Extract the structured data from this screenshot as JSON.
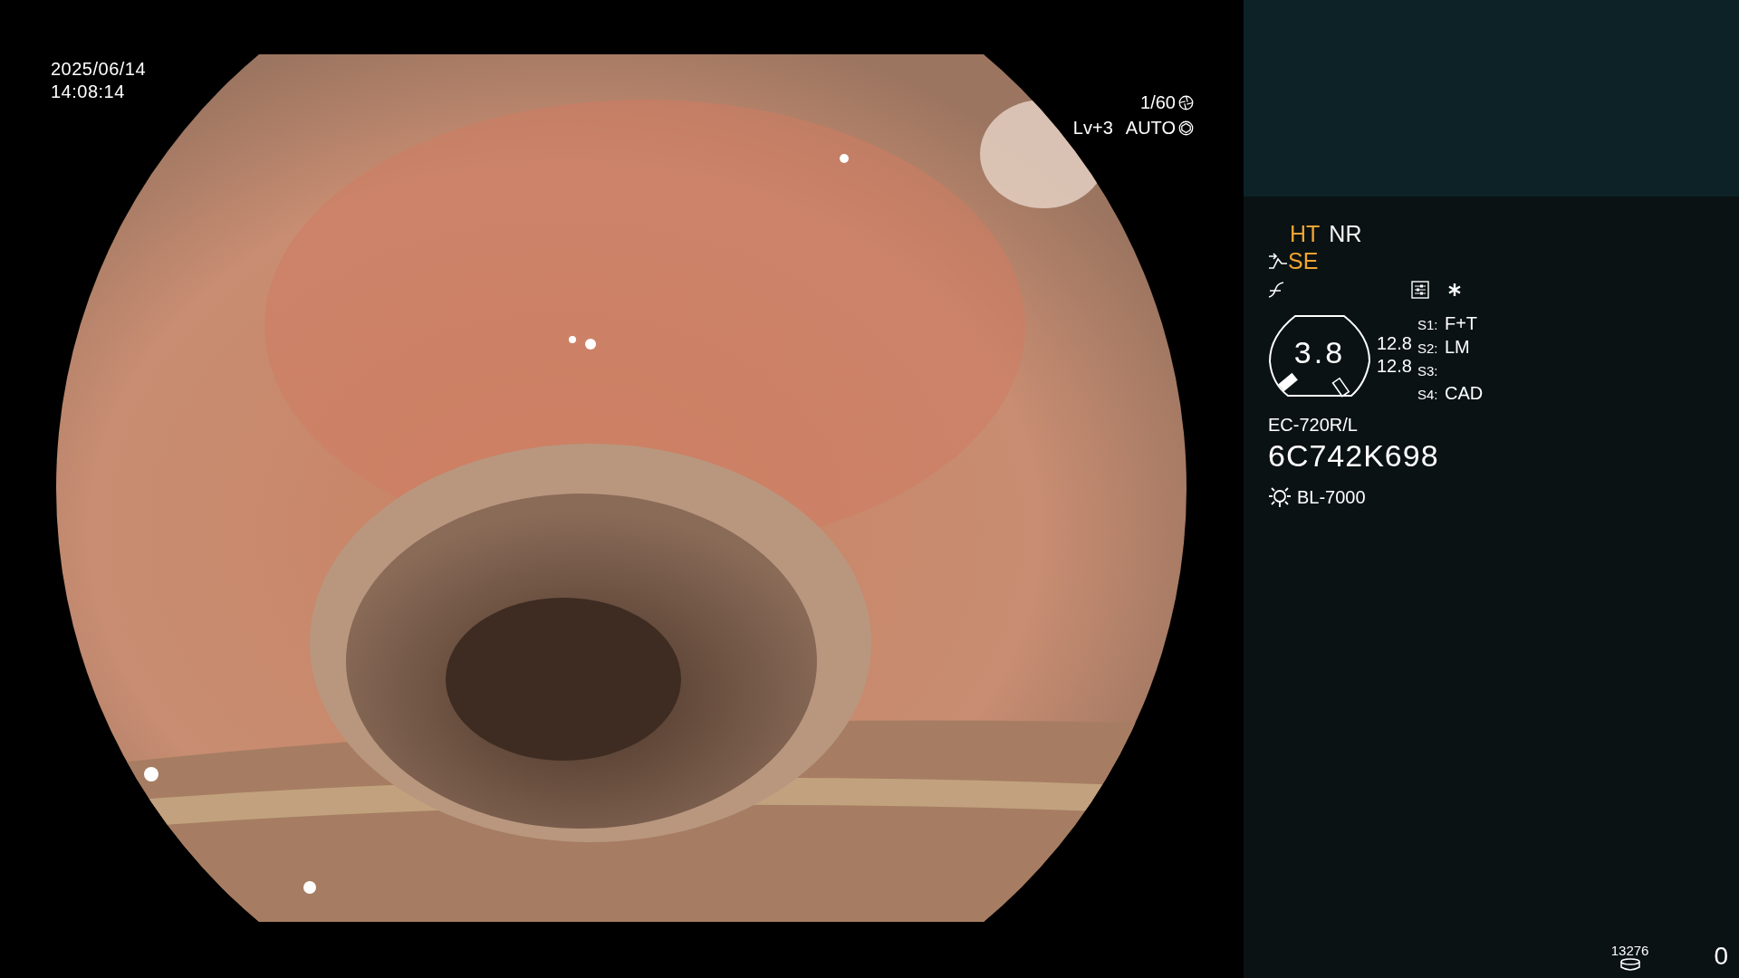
{
  "capture": {
    "date": "2025/06/14",
    "time": "14:08:14"
  },
  "exposure": {
    "shutter": "1/60",
    "level": "Lv+3",
    "mode": "AUTO"
  },
  "panel": {
    "modes": [
      {
        "label": "HT",
        "active": true
      },
      {
        "label": "NR",
        "active": false
      }
    ],
    "enhancement": {
      "label": "SE",
      "active": true
    },
    "zoom": {
      "value": "3.8",
      "readings": [
        "12.8",
        "12.8"
      ]
    },
    "switches": [
      {
        "key": "S1:",
        "value": "F+T"
      },
      {
        "key": "S2:",
        "value": "LM"
      },
      {
        "key": "S3:"
      },
      {
        "key": "S4:",
        "value": "CAD"
      }
    ],
    "scope": {
      "model": "EC-720R/L",
      "serial": "6C742K698"
    },
    "light_source": "BL-7000",
    "storage": {
      "remaining": "13276",
      "count": "0"
    }
  }
}
